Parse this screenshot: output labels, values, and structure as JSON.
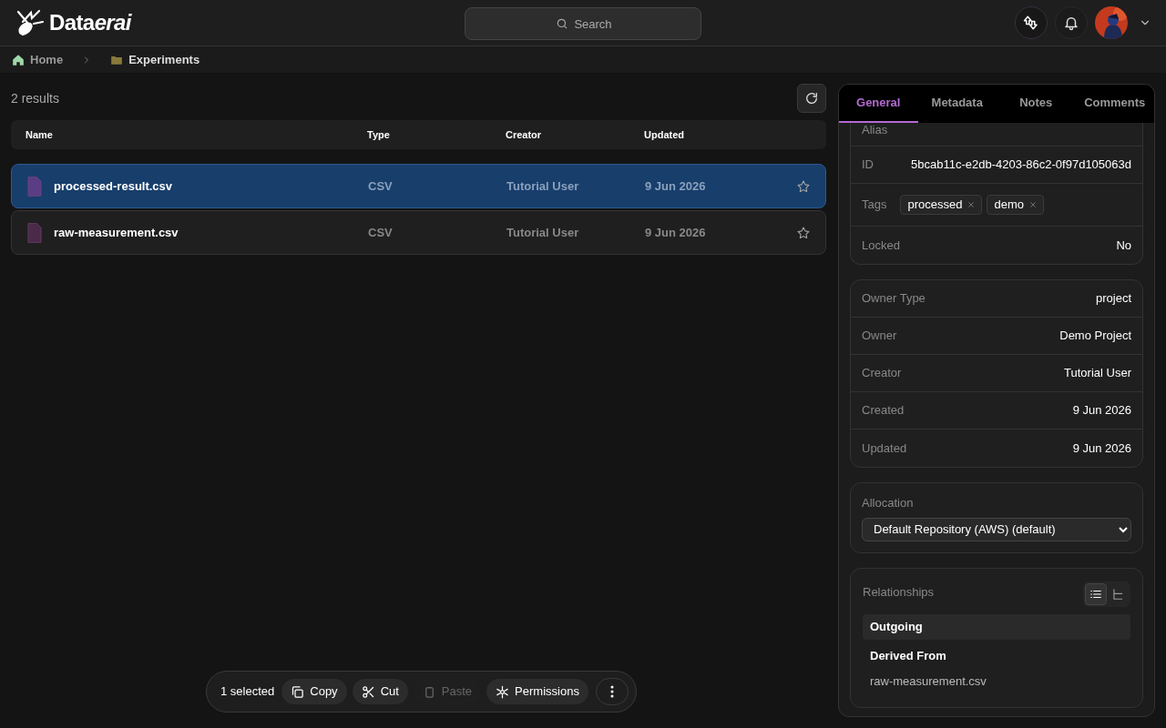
{
  "header": {
    "logo": {
      "plain": "Data",
      "italic": "erai"
    },
    "search": {
      "placeholder": "Search"
    }
  },
  "breadcrumbs": [
    {
      "label": "Home",
      "kind": "home"
    },
    {
      "label": "Experiments",
      "kind": "folder"
    }
  ],
  "results_count": "2 results",
  "table": {
    "columns": [
      "Name",
      "Type",
      "Creator",
      "Updated"
    ],
    "rows": [
      {
        "name": "processed-result.csv",
        "type": "CSV",
        "creator": "Tutorial User",
        "updated": "9 Jun 2026",
        "selected": true,
        "starred": false
      },
      {
        "name": "raw-measurement.csv",
        "type": "CSV",
        "creator": "Tutorial User",
        "updated": "9 Jun 2026",
        "selected": false,
        "starred": false
      }
    ]
  },
  "selection_bar": {
    "count": "1 selected",
    "actions": [
      {
        "label": "Copy",
        "kind": "copy",
        "disabled": false
      },
      {
        "label": "Cut",
        "kind": "cut",
        "disabled": false
      },
      {
        "label": "Paste",
        "kind": "paste",
        "disabled": true
      },
      {
        "label": "Permissions",
        "kind": "permissions",
        "disabled": false
      }
    ]
  },
  "details": {
    "tabs": [
      {
        "label": "General",
        "selected": true
      },
      {
        "label": "Metadata",
        "selected": false
      },
      {
        "label": "Notes",
        "selected": false
      },
      {
        "label": "Comments",
        "selected": false
      }
    ],
    "alias_label": "Alias",
    "id": {
      "label": "ID",
      "value": "5bcab11c-e2db-4203-86c2-0f97d105063d"
    },
    "tags": {
      "label": "Tags",
      "items": [
        "processed",
        "demo"
      ]
    },
    "locked": {
      "label": "Locked",
      "value": "No"
    },
    "ownership": [
      {
        "label": "Owner Type",
        "value": "project"
      },
      {
        "label": "Owner",
        "value": "Demo Project"
      },
      {
        "label": "Creator",
        "value": "Tutorial User"
      },
      {
        "label": "Created",
        "value": "9 Jun 2026"
      },
      {
        "label": "Updated",
        "value": "9 Jun 2026"
      }
    ],
    "allocation": {
      "label": "Allocation",
      "value": "Default Repository (AWS) (default)"
    },
    "relationships": {
      "title": "Relationships",
      "views": [
        {
          "kind": "list",
          "selected": true
        },
        {
          "kind": "tree",
          "selected": false
        }
      ],
      "section": "Outgoing",
      "group": "Derived From",
      "items": [
        "raw-measurement.csv"
      ]
    }
  }
}
